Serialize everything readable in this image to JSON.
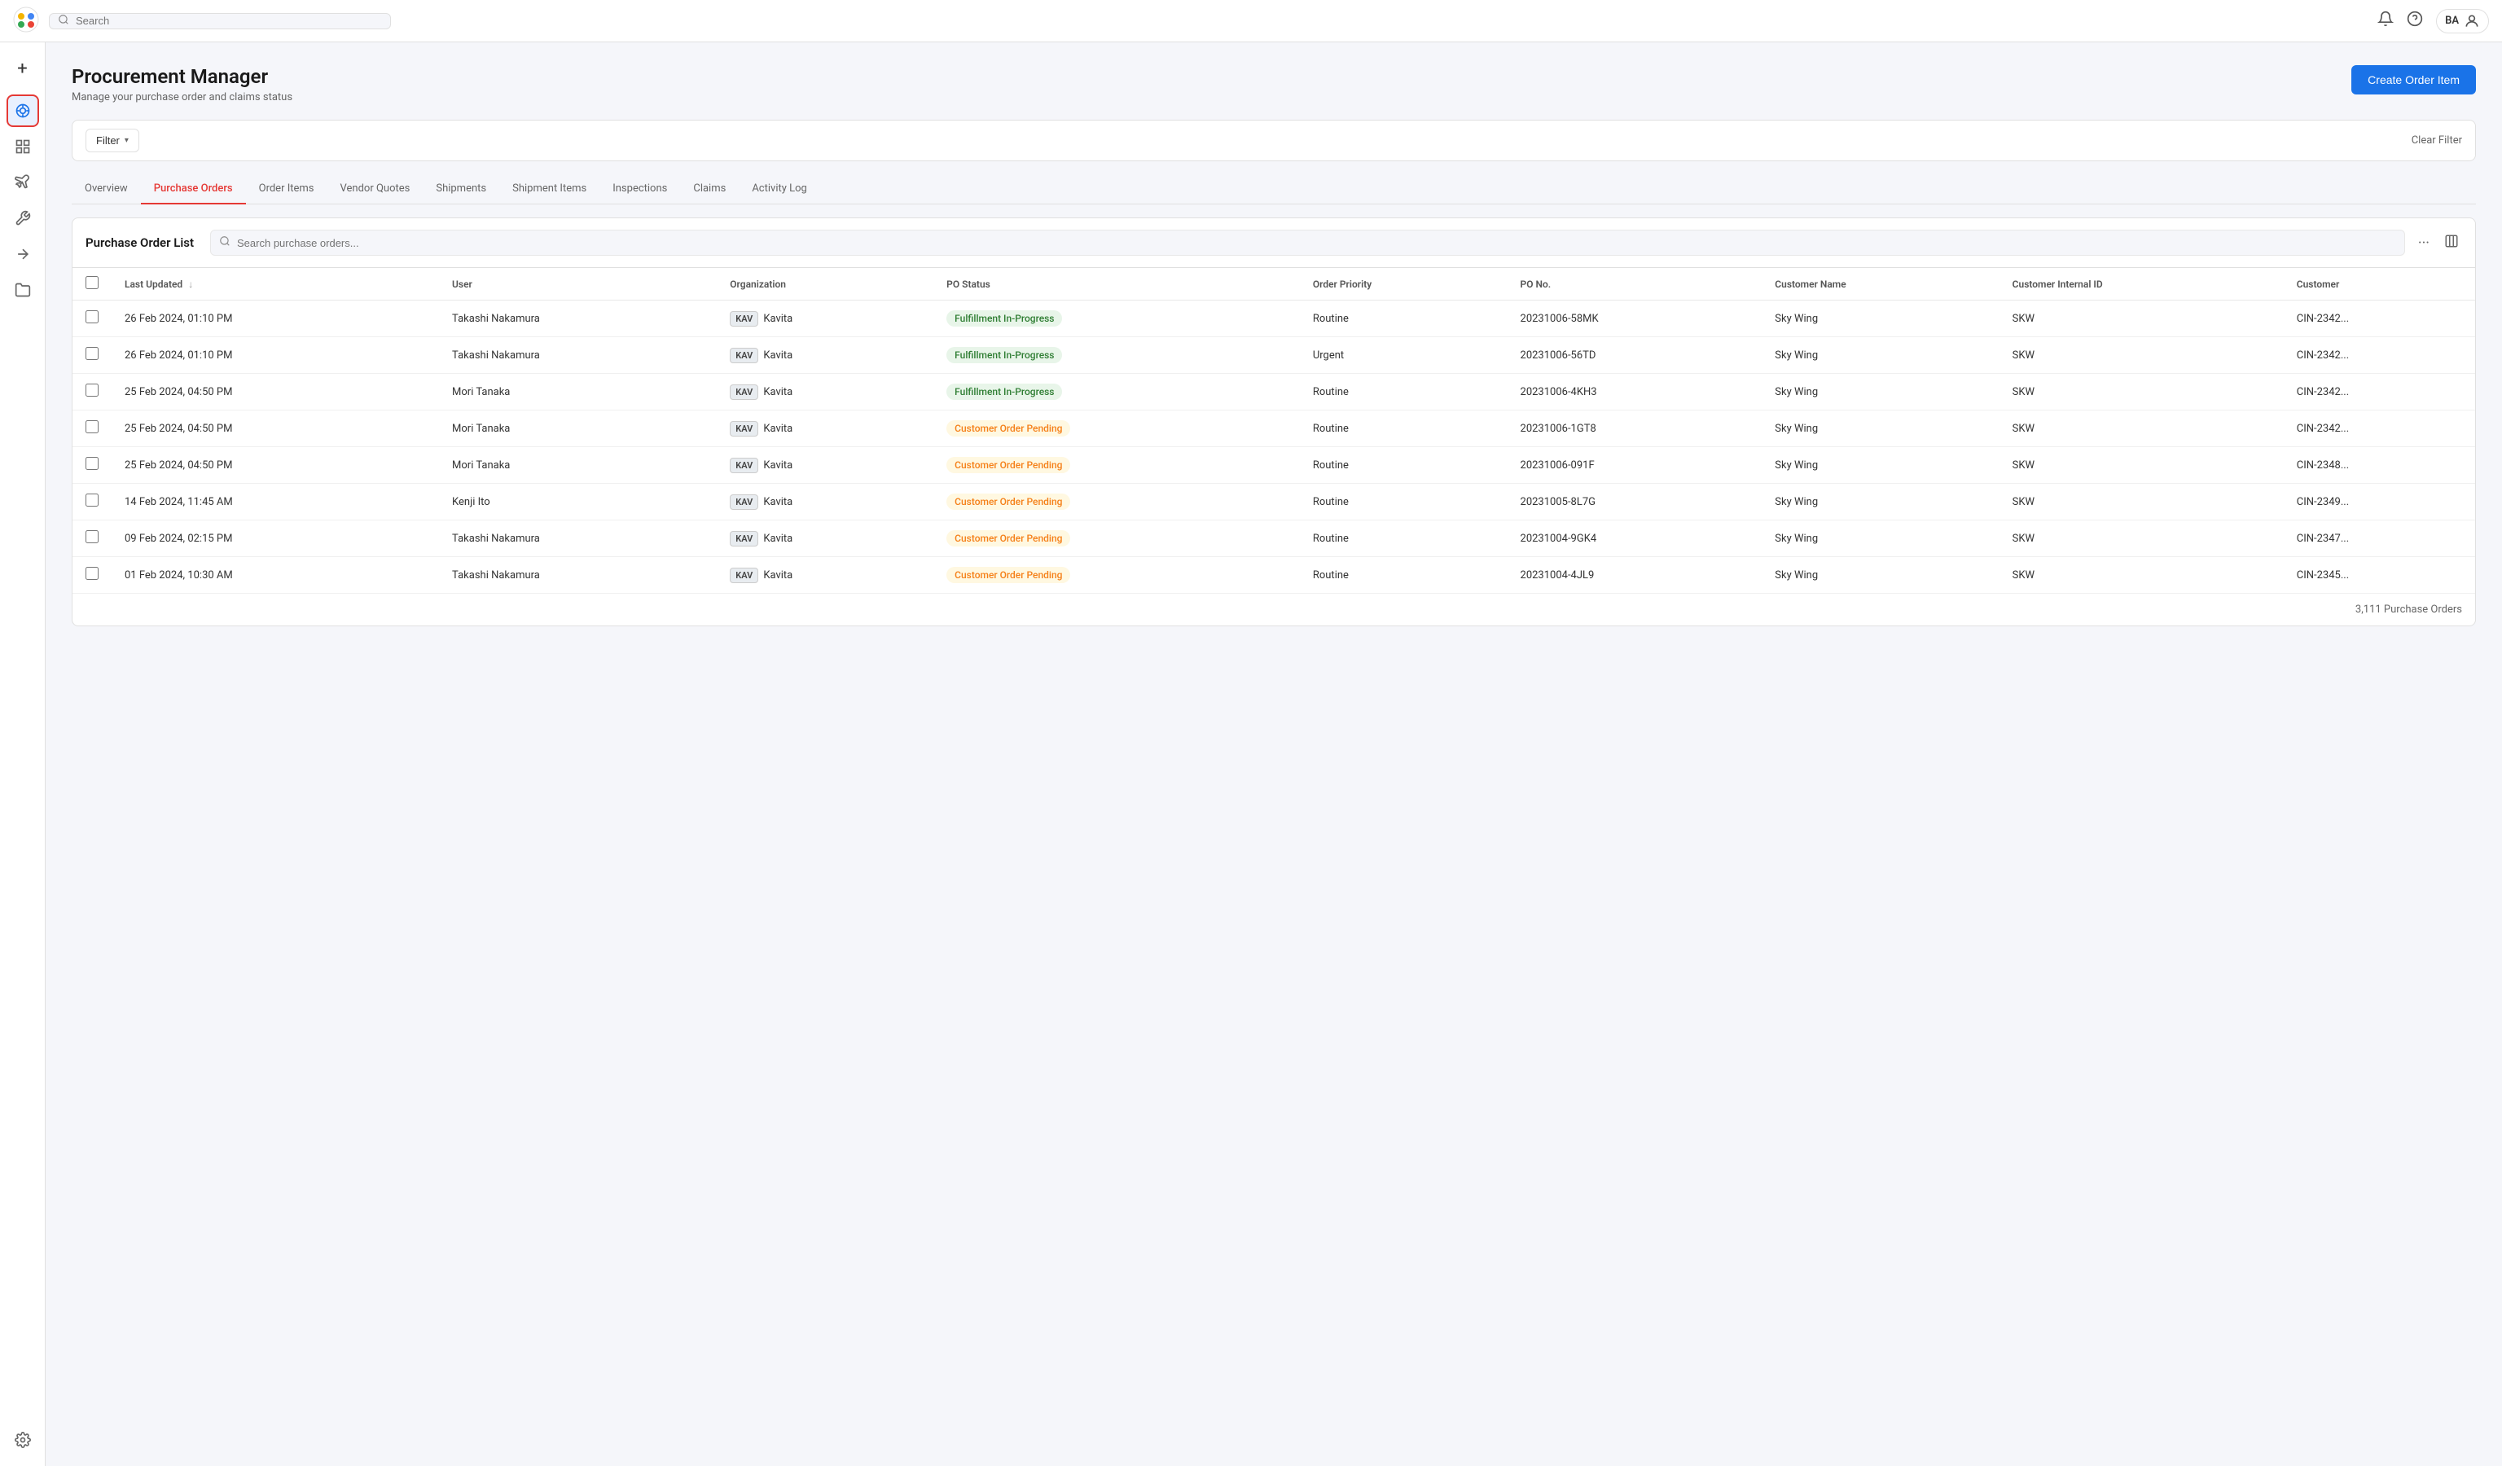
{
  "topbar": {
    "search_placeholder": "Search",
    "user_initials": "BA"
  },
  "sidebar": {
    "items": [
      {
        "id": "add",
        "icon": "+",
        "label": "Add"
      },
      {
        "id": "procurement",
        "icon": "◎",
        "label": "Procurement Manager",
        "active": true
      },
      {
        "id": "analytics",
        "icon": "▦",
        "label": "Analytics"
      },
      {
        "id": "flights",
        "icon": "✈",
        "label": "Flights"
      },
      {
        "id": "tools",
        "icon": "⚒",
        "label": "Tools"
      },
      {
        "id": "arrows",
        "icon": "⇄",
        "label": "Transfers"
      },
      {
        "id": "folders",
        "icon": "⊟",
        "label": "Documents"
      },
      {
        "id": "settings",
        "icon": "⚙",
        "label": "Settings"
      }
    ]
  },
  "page": {
    "title": "Procurement Manager",
    "subtitle": "Manage your purchase order and claims status",
    "create_button_label": "Create Order Item"
  },
  "filter_bar": {
    "filter_label": "Filter",
    "clear_label": "Clear Filter"
  },
  "tabs": [
    {
      "id": "overview",
      "label": "Overview",
      "active": false
    },
    {
      "id": "purchase-orders",
      "label": "Purchase Orders",
      "active": true
    },
    {
      "id": "order-items",
      "label": "Order Items",
      "active": false
    },
    {
      "id": "vendor-quotes",
      "label": "Vendor Quotes",
      "active": false
    },
    {
      "id": "shipments",
      "label": "Shipments",
      "active": false
    },
    {
      "id": "shipment-items",
      "label": "Shipment Items",
      "active": false
    },
    {
      "id": "inspections",
      "label": "Inspections",
      "active": false
    },
    {
      "id": "claims",
      "label": "Claims",
      "active": false
    },
    {
      "id": "activity-log",
      "label": "Activity Log",
      "active": false
    }
  ],
  "table": {
    "title": "Purchase Order List",
    "search_placeholder": "Search purchase orders...",
    "footer": "3,111 Purchase Orders",
    "columns": [
      {
        "id": "last-updated",
        "label": "Last Updated",
        "sortable": true
      },
      {
        "id": "user",
        "label": "User"
      },
      {
        "id": "organization",
        "label": "Organization"
      },
      {
        "id": "po-status",
        "label": "PO Status"
      },
      {
        "id": "order-priority",
        "label": "Order Priority"
      },
      {
        "id": "po-no",
        "label": "PO No."
      },
      {
        "id": "customer-name",
        "label": "Customer Name"
      },
      {
        "id": "customer-internal-id",
        "label": "Customer Internal ID"
      },
      {
        "id": "customer",
        "label": "Customer"
      }
    ],
    "rows": [
      {
        "last_updated": "26 Feb 2024, 01:10 PM",
        "user": "Takashi Nakamura",
        "org_tag": "KAV",
        "org_name": "Kavita",
        "po_status": "Fulfillment In-Progress",
        "po_status_type": "fulfillment",
        "order_priority": "Routine",
        "po_no": "20231006-58MK",
        "customer_name": "Sky Wing",
        "customer_internal_id": "SKW",
        "customer": "CIN-2342"
      },
      {
        "last_updated": "26 Feb 2024, 01:10 PM",
        "user": "Takashi Nakamura",
        "org_tag": "KAV",
        "org_name": "Kavita",
        "po_status": "Fulfillment In-Progress",
        "po_status_type": "fulfillment",
        "order_priority": "Urgent",
        "po_no": "20231006-56TD",
        "customer_name": "Sky Wing",
        "customer_internal_id": "SKW",
        "customer": "CIN-2342"
      },
      {
        "last_updated": "25 Feb 2024, 04:50 PM",
        "user": "Mori Tanaka",
        "org_tag": "KAV",
        "org_name": "Kavita",
        "po_status": "Fulfillment In-Progress",
        "po_status_type": "fulfillment",
        "order_priority": "Routine",
        "po_no": "20231006-4KH3",
        "customer_name": "Sky Wing",
        "customer_internal_id": "SKW",
        "customer": "CIN-2342"
      },
      {
        "last_updated": "25 Feb 2024, 04:50 PM",
        "user": "Mori Tanaka",
        "org_tag": "KAV",
        "org_name": "Kavita",
        "po_status": "Customer Order Pending",
        "po_status_type": "pending",
        "order_priority": "Routine",
        "po_no": "20231006-1GT8",
        "customer_name": "Sky Wing",
        "customer_internal_id": "SKW",
        "customer": "CIN-2342"
      },
      {
        "last_updated": "25 Feb 2024, 04:50 PM",
        "user": "Mori Tanaka",
        "org_tag": "KAV",
        "org_name": "Kavita",
        "po_status": "Customer Order Pending",
        "po_status_type": "pending",
        "order_priority": "Routine",
        "po_no": "20231006-091F",
        "customer_name": "Sky Wing",
        "customer_internal_id": "SKW",
        "customer": "CIN-2348"
      },
      {
        "last_updated": "14 Feb 2024, 11:45 AM",
        "user": "Kenji Ito",
        "org_tag": "KAV",
        "org_name": "Kavita",
        "po_status": "Customer Order Pending",
        "po_status_type": "pending",
        "order_priority": "Routine",
        "po_no": "20231005-8L7G",
        "customer_name": "Sky Wing",
        "customer_internal_id": "SKW",
        "customer": "CIN-2349"
      },
      {
        "last_updated": "09 Feb 2024, 02:15 PM",
        "user": "Takashi Nakamura",
        "org_tag": "KAV",
        "org_name": "Kavita",
        "po_status": "Customer Order Pending",
        "po_status_type": "pending",
        "order_priority": "Routine",
        "po_no": "20231004-9GK4",
        "customer_name": "Sky Wing",
        "customer_internal_id": "SKW",
        "customer": "CIN-2347"
      },
      {
        "last_updated": "01 Feb 2024, 10:30 AM",
        "user": "Takashi Nakamura",
        "org_tag": "KAV",
        "org_name": "Kavita",
        "po_status": "Customer Order Pending",
        "po_status_type": "pending",
        "order_priority": "Routine",
        "po_no": "20231004-4JL9",
        "customer_name": "Sky Wing",
        "customer_internal_id": "SKW",
        "customer": "CIN-2345"
      }
    ]
  }
}
